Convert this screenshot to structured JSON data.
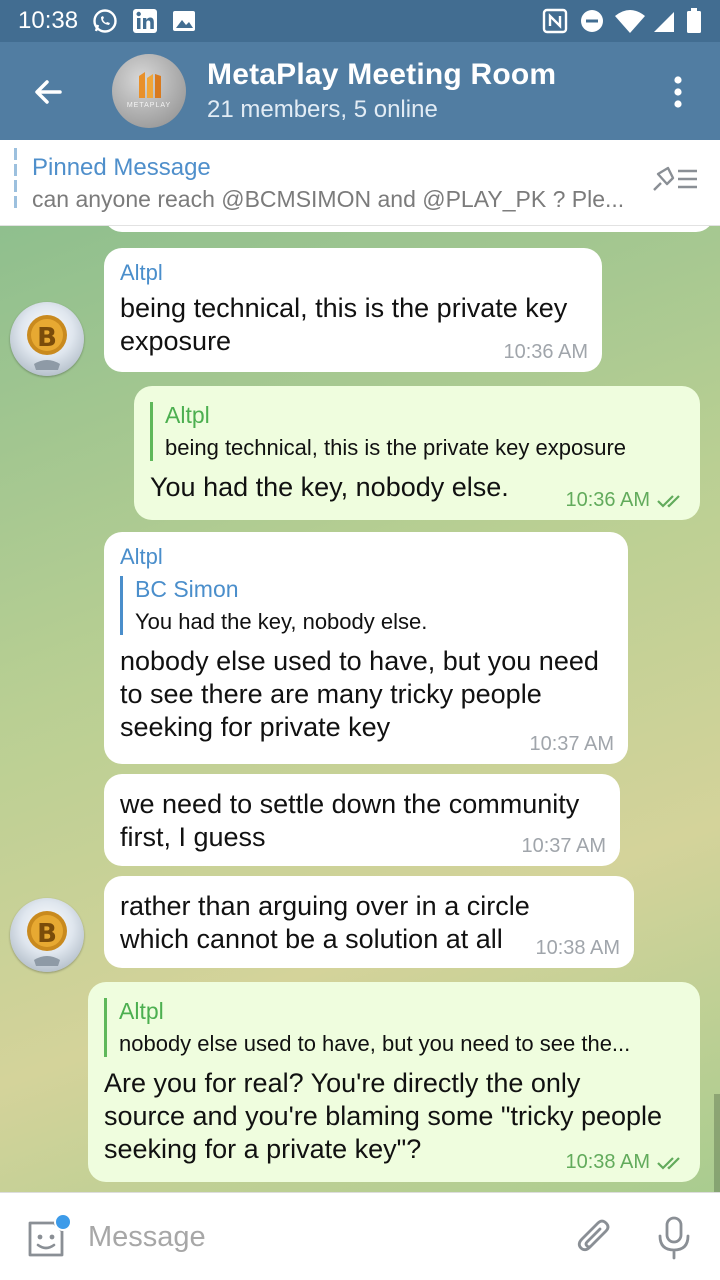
{
  "status_bar": {
    "time": "10:38",
    "left_icons": [
      "whatsapp-icon",
      "linkedin-icon",
      "gallery-icon"
    ],
    "right_icons": [
      "nfc-icon",
      "do-not-disturb-icon",
      "wifi-icon",
      "signal-icon",
      "battery-icon"
    ]
  },
  "header": {
    "title": "MetaPlay Meeting Room",
    "subtitle": "21 members, 5 online",
    "avatar_text": "METAPLAY",
    "color": "#517da2"
  },
  "pinned": {
    "title": "Pinned Message",
    "text": "can anyone reach @BCMSIMON  and @PLAY_PK ? Ple..."
  },
  "messages": [
    {
      "id": "m1",
      "direction": "in",
      "sender": "Altpl",
      "text_lines": [
        "being technical, this is the private key",
        "exposure"
      ],
      "time": "10:36 AM"
    },
    {
      "id": "m2",
      "direction": "out",
      "reply_to": {
        "name": "Altpl",
        "text": "being technical, this is the private key exposure"
      },
      "text": "You had the key, nobody else.",
      "time": "10:36 AM",
      "read": true
    },
    {
      "id": "m3",
      "direction": "in",
      "sender": "Altpl",
      "reply_to": {
        "name": "BC Simon",
        "text": "You had the key, nobody else."
      },
      "text_lines": [
        "nobody else used to have, but you need",
        "to see there are many tricky people",
        "seeking for private key"
      ],
      "time": "10:37 AM"
    },
    {
      "id": "m4",
      "direction": "in",
      "text_lines": [
        "we need to settle down the community",
        "first, I guess"
      ],
      "time": "10:37 AM"
    },
    {
      "id": "m5",
      "direction": "in",
      "text_lines": [
        "rather than arguing over in a circle",
        "which cannot be a solution at all"
      ],
      "time": "10:38 AM"
    },
    {
      "id": "m6",
      "direction": "out",
      "reply_to": {
        "name": "Altpl",
        "text": "nobody else used to have, but you need to see the..."
      },
      "text_lines": [
        "Are you for real? You're directly the only",
        "source and you're blaming some \"tricky people",
        "seeking for a private key\"?"
      ],
      "time": "10:38 AM",
      "read": true
    }
  ],
  "input": {
    "placeholder": "Message"
  },
  "colors": {
    "header": "#517da2",
    "status_bar": "#426d91",
    "incoming_bubble": "#ffffff",
    "outgoing_bubble": "#effdde",
    "link_blue": "#4a8ecb",
    "reply_green": "#4caf50"
  }
}
